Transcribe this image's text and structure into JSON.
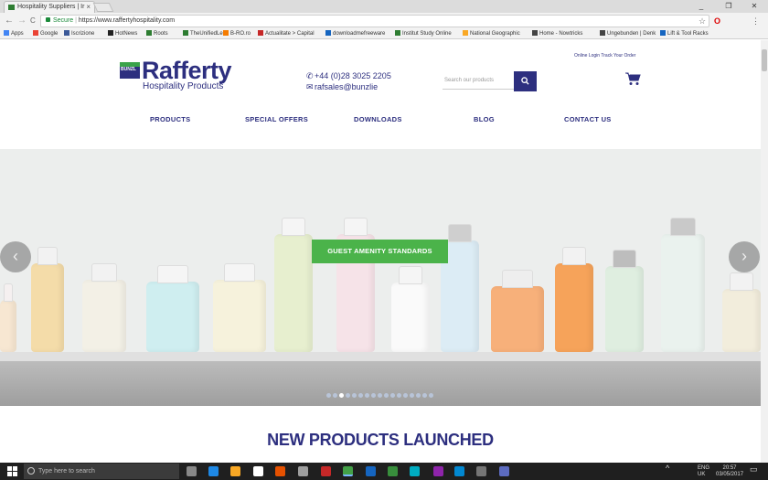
{
  "browser": {
    "tab_title": "Hospitality Suppliers | Ir",
    "tab_close": "×",
    "window_controls": [
      "_",
      "❐",
      "✕"
    ],
    "nav": {
      "back": "←",
      "forward": "→",
      "reload": "C"
    },
    "url": {
      "secure_label": "Secure",
      "separator": "|",
      "address": "https://www.raffertyhospitality.com"
    },
    "url_icons": {
      "star": "☆",
      "opera": "O",
      "menu": "⋮"
    },
    "bookmarks": [
      {
        "label": "Apps",
        "color": "#4285f4"
      },
      {
        "label": "Google",
        "color": "#ea4335"
      },
      {
        "label": "Iscrizione",
        "color": "#3b5998"
      },
      {
        "label": "HotNews",
        "color": "#222222"
      },
      {
        "label": "Roots",
        "color": "#2e7d32"
      },
      {
        "label": "TheUnifiedLe",
        "color": "#2e7d32"
      },
      {
        "label": "B-RO.ro",
        "color": "#f57c00"
      },
      {
        "label": "Actualitate > Capital",
        "color": "#c62828"
      },
      {
        "label": "downloadmefreeware",
        "color": "#1565c0"
      },
      {
        "label": "Institut Study Online",
        "color": "#2e7d32"
      },
      {
        "label": "National Geographic",
        "color": "#f9a825"
      },
      {
        "label": "Home - Nowtricks",
        "color": "#444444"
      },
      {
        "label": "Ungebunden | Denk",
        "color": "#444444"
      },
      {
        "label": "Lift & Tool Racks",
        "color": "#1565c0"
      }
    ]
  },
  "header": {
    "logo": {
      "badge": "BUNZL",
      "name": "Rafferty",
      "subtitle": "Hospitality Products"
    },
    "phone": "+44 (0)28 3025 2205",
    "email": "rafsales@bunzlie",
    "top_links": "Online Login   Track Your Order",
    "search_placeholder": "Search our products",
    "menu": [
      "PRODUCTS",
      "SPECIAL OFFERS",
      "DOWNLOADS",
      "BLOG",
      "CONTACT US"
    ]
  },
  "hero": {
    "button_label": "GUEST AMENITY STANDARDS",
    "prev_arrow": "‹",
    "next_arrow": "›",
    "slide_count": 17,
    "active_slide": 3
  },
  "section": {
    "heading": "NEW PRODUCTS LAUNCHED"
  },
  "taskbar": {
    "search_placeholder": "Type here to search",
    "tray_lang": "ENG",
    "tray_region": "UK",
    "time": "20:57",
    "date": "03/05/2017"
  }
}
